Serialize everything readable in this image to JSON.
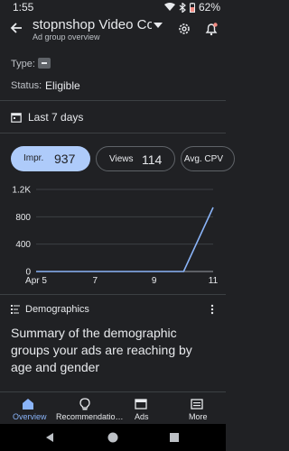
{
  "status_bar": {
    "time": "1:55",
    "battery": "62%"
  },
  "app_bar": {
    "title": "stopnshop Video Cor",
    "subtitle": "Ad group overview"
  },
  "info": {
    "type_label": "Type:",
    "status_label": "Status:",
    "status_value": "Eligible"
  },
  "date_range": {
    "label": "Last 7 days"
  },
  "metrics": [
    {
      "name": "Impr.",
      "value": "937"
    },
    {
      "name": "Views",
      "value": "114"
    },
    {
      "name": "Avg. CPV"
    }
  ],
  "chart_data": {
    "type": "line",
    "x": [
      "Apr 5",
      "Apr 6",
      "Apr 7",
      "Apr 8",
      "Apr 9",
      "Apr 10",
      "Apr 11"
    ],
    "y": [
      0,
      0,
      0,
      0,
      0,
      0,
      937
    ],
    "x_tick_labels": [
      "Apr 5",
      "7",
      "9",
      "11"
    ],
    "y_tick_labels": [
      "0",
      "400",
      "800",
      "1.2K"
    ],
    "ylim": [
      0,
      1200
    ],
    "color": "#8ab4f8",
    "grid": true
  },
  "demographics": {
    "label": "Demographics",
    "summary": "Summary of the demographic groups your ads are reaching by age and gender"
  },
  "bottom_nav": [
    {
      "label": "Overview",
      "icon": "home-icon",
      "active": true
    },
    {
      "label": "Recommendatio…",
      "icon": "lightbulb-icon",
      "active": false
    },
    {
      "label": "Ads",
      "icon": "ads-icon",
      "active": false
    },
    {
      "label": "More",
      "icon": "more-icon",
      "active": false
    }
  ],
  "colors": {
    "background": "#202124",
    "accent": "#8ab4f8",
    "chip_selected": "#aecbfa",
    "battery_alert": "#f28b82"
  }
}
